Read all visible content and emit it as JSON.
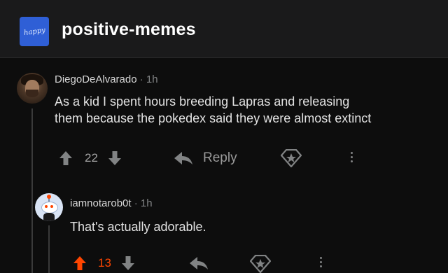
{
  "header": {
    "icon_text": "happy",
    "subreddit": "positive-memes"
  },
  "comments": [
    {
      "username": "DiegoDeAlvarado",
      "separator": "·",
      "age": "1h",
      "lines": [
        "As a kid I spent hours breeding Lapras and releasing",
        "them because the pokedex said they were almost extinct"
      ],
      "score": "22",
      "reply_label": "Reply",
      "upvoted": false
    },
    {
      "username": "iamnotarob0t",
      "separator": "·",
      "age": "1h",
      "lines": [
        "That's actually adorable."
      ],
      "score": "13",
      "upvoted": true
    }
  ],
  "colors": {
    "background": "#0d0d0d",
    "header": "#1a1a1b",
    "upvote_active": "#ff4500",
    "muted": "#818384"
  },
  "icons": [
    "upvote-arrow-icon",
    "downvote-arrow-icon",
    "reply-arrow-icon",
    "award-icon",
    "more-options-icon"
  ]
}
